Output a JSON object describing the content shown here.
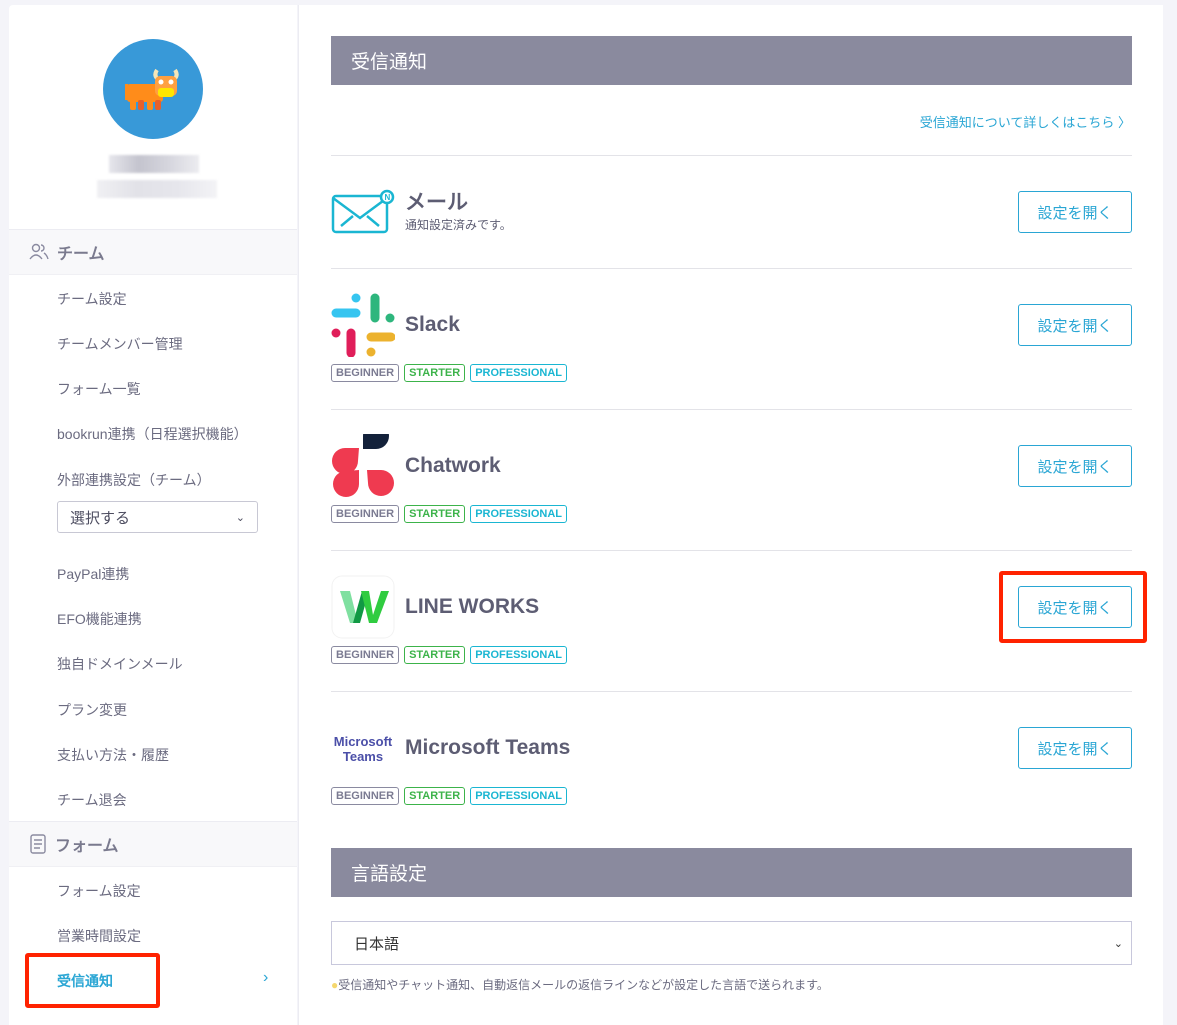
{
  "sidebar": {
    "team_header": "チーム",
    "team_items": [
      "チーム設定",
      "チームメンバー管理",
      "フォーム一覧",
      "bookrun連携（日程選択機能）",
      "外部連携設定（チーム）"
    ],
    "select_value": "選択する",
    "team_items2": [
      "PayPal連携",
      "EFO機能連携",
      "独自ドメインメール",
      "プラン変更",
      "支払い方法・履歴",
      "チーム退会"
    ],
    "form_header": "フォーム",
    "form_items": [
      "フォーム設定",
      "営業時間設定",
      "受信通知"
    ]
  },
  "main": {
    "title": "受信通知",
    "help_link": "受信通知について詳しくはこちら",
    "button_label": "設定を開く",
    "badges": [
      "BEGINNER",
      "STARTER",
      "PROFESSIONAL"
    ],
    "mail": {
      "name": "メール",
      "status": "通知設定済みです。"
    },
    "services": [
      "Slack",
      "Chatwork",
      "LINE WORKS",
      "Microsoft Teams"
    ],
    "teams_logo": [
      "Microsoft",
      "Teams"
    ],
    "lang_title": "言語設定",
    "lang_value": "日本語",
    "lang_note": "受信通知やチャット通知、自動返信メールの返信ラインなどが設定した言語で送られます。"
  },
  "colors": {
    "accent": "#2aa6d4",
    "header": "#8a8a9e",
    "highlight": "#ff2200"
  }
}
